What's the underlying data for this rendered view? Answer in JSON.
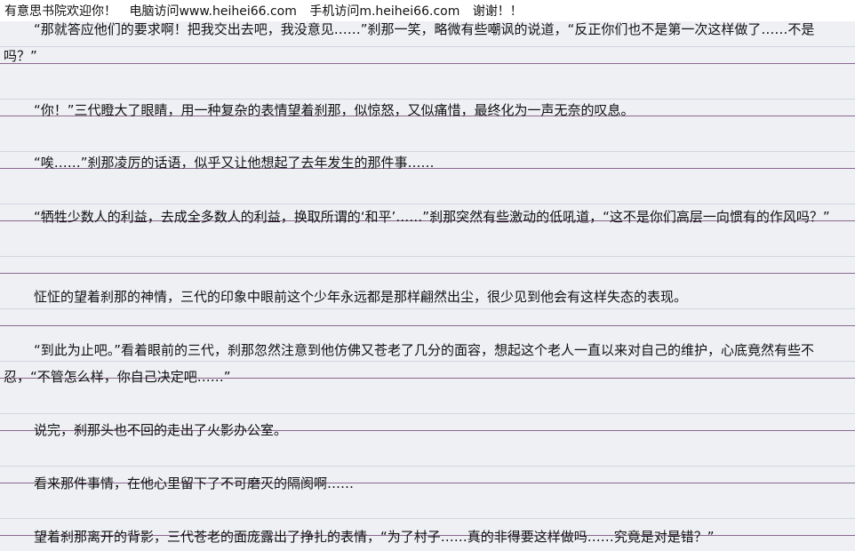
{
  "header": {
    "site_name": "有意思书院欢迎你！",
    "pc_visit": "电脑访问www.heihei66.com",
    "mobile_visit": "手机访问m.heihei66.com",
    "thanks": "谢谢！！"
  },
  "paragraphs": [
    "“那就答应他们的要求啊！把我交出去吧，我没意见……”刹那一笑，略微有些嘲讽的说道，“反正你们也不是第一次这样做了……不是吗？”",
    "“你！”三代瞪大了眼睛，用一种复杂的表情望着刹那，似惊怒，又似痛惜，最终化为一声无奈的叹息。",
    "“唉……”刹那凌厉的话语，似乎又让他想起了去年发生的那件事……",
    "“牺牲少数人的利益，去成全多数人的利益，换取所谓的‘和平’……”刹那突然有些激动的低吼道，“这不是你们高层一向惯有的作风吗？”",
    "怔怔的望着刹那的神情，三代的印象中眼前这个少年永远都是那样翩然出尘，很少见到他会有这样失态的表现。",
    "“到此为止吧。”看着眼前的三代，刹那忽然注意到他仿佛又苍老了几分的面容，想起这个老人一直以来对自己的维护，心底竟然有些不忍，“不管怎么样，你自己决定吧……”",
    "说完，刹那头也不回的走出了火影办公室。",
    "看来那件事情，在他心里留下了不可磨灭的隔阂啊……",
    "望着刹那离开的背影，三代苍老的面庞露出了挣扎的表情，“为了村子……真的非得要这样做吗……究竟是对是错？”"
  ]
}
